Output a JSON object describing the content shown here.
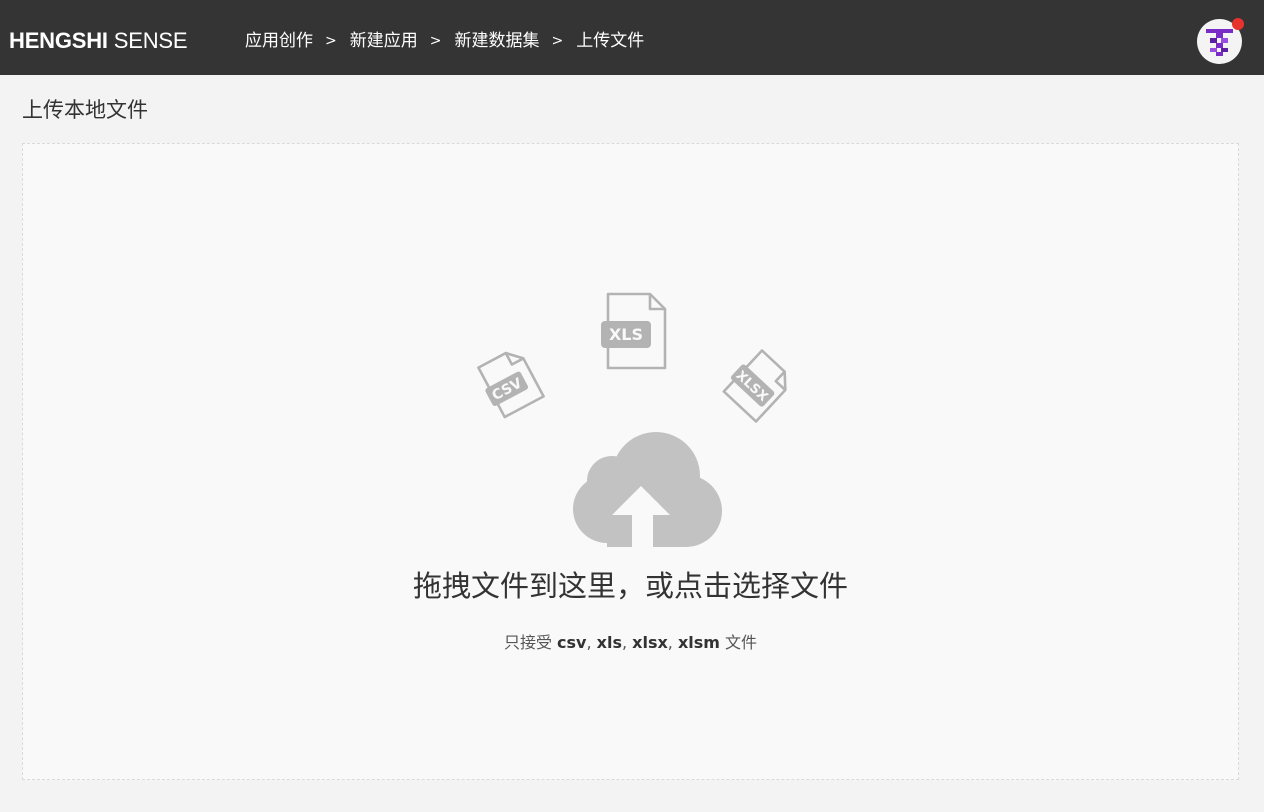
{
  "header": {
    "brand_bold": "HENGSHI",
    "brand_light": " SENSE",
    "breadcrumb": [
      "应用创作",
      "新建应用",
      "新建数据集",
      "上传文件"
    ],
    "separator": ">"
  },
  "upload": {
    "title": "上传本地文件",
    "main_text": "拖拽文件到这里，或点击选择文件",
    "hint_prefix": "只接受 ",
    "formats": [
      "csv",
      "xls",
      "xlsx",
      "xlsm"
    ],
    "hint_suffix": " 文件",
    "file_icons": [
      "CSV",
      "XLS",
      "XLSX"
    ]
  },
  "colors": {
    "topbar": "#343434",
    "accent": "#7a2cc7",
    "notify": "#e8322d",
    "icon_gray": "#b3b3b3"
  }
}
